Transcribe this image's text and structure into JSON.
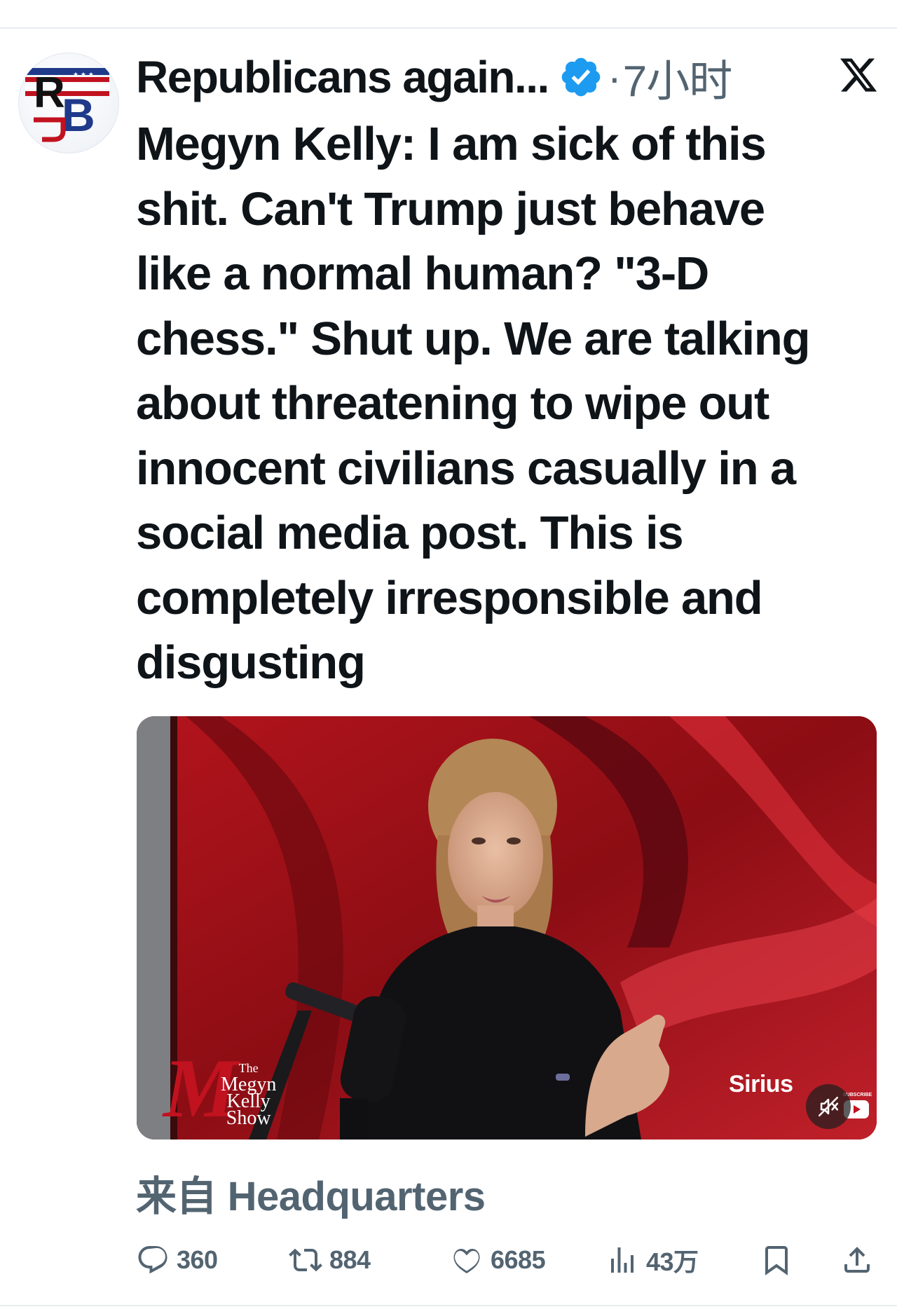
{
  "tweet": {
    "author_name": "Republicans again...",
    "verified": true,
    "separator": "·",
    "timestamp": "7小时",
    "text": "Megyn Kelly: I am sick of this\nshit. Can't Trump just behave\nlike a normal human? \"3-D\nchess.\" Shut up. We are talking\nabout threatening to wipe out\ninnocent civilians casually in a\nsocial media post. This is\ncompletely irresponsible and\ndisgusting",
    "source": "来自 Headquarters"
  },
  "video": {
    "show_logo": {
      "mark": "M",
      "line1": "The",
      "line2": "Megyn",
      "line3": "Kelly",
      "line4": "Show"
    },
    "network_logo": "Sirius",
    "subscribe": "SUBSCRIBE",
    "muted": true
  },
  "actions": {
    "replies": "360",
    "retweets": "884",
    "likes": "6685",
    "views": "43万"
  },
  "colors": {
    "text": "#0f1419",
    "secondary": "#536471",
    "verified": "#1d9bf0",
    "brand_red": "#c1121f",
    "brand_blue": "#1f3a8a"
  },
  "icons": {
    "verified": "verified-badge-icon",
    "platform": "x-logo-icon",
    "reply": "reply-icon",
    "retweet": "retweet-icon",
    "like": "heart-icon",
    "views": "views-icon",
    "bookmark": "bookmark-icon",
    "share": "share-icon",
    "mute": "muted-speaker-icon",
    "youtube": "youtube-icon"
  }
}
